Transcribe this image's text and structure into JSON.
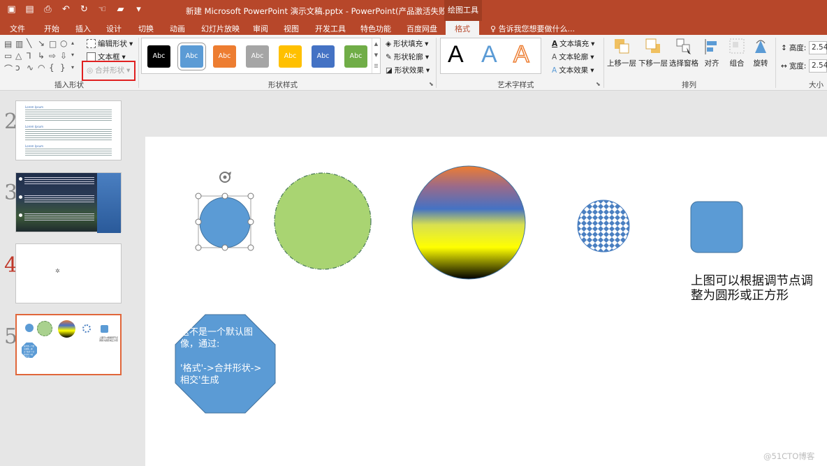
{
  "titlebar": {
    "title": "新建 Microsoft PowerPoint 演示文稿.pptx - PowerPoint(产品激活失败)",
    "context_tab": "绘图工具"
  },
  "tabs": [
    "文件",
    "开始",
    "插入",
    "设计",
    "切换",
    "动画",
    "幻灯片放映",
    "审阅",
    "视图",
    "开发工具",
    "特色功能",
    "百度网盘",
    "格式"
  ],
  "tell_me": "告诉我您想要做什么...",
  "ribbon": {
    "insert_shapes": {
      "edit_shape": "编辑形状",
      "text_box": "文本框",
      "merge_shapes": "合并形状",
      "label": "插入形状"
    },
    "shape_styles": {
      "swatches": [
        {
          "text": "Abc",
          "bg": "#000000",
          "fg": "#ffffff"
        },
        {
          "text": "Abc",
          "bg": "#5b9bd5",
          "fg": "#ffffff"
        },
        {
          "text": "Abc",
          "bg": "#ed7d31",
          "fg": "#ffffff"
        },
        {
          "text": "Abc",
          "bg": "#a5a5a5",
          "fg": "#ffffff"
        },
        {
          "text": "Abc",
          "bg": "#ffc000",
          "fg": "#ffffff"
        },
        {
          "text": "Abc",
          "bg": "#4472c4",
          "fg": "#ffffff"
        },
        {
          "text": "Abc",
          "bg": "#70ad47",
          "fg": "#ffffff"
        }
      ],
      "fill": "形状填充",
      "outline": "形状轮廓",
      "effects": "形状效果",
      "label": "形状样式"
    },
    "wordart": {
      "letter": "A",
      "text_fill": "文本填充",
      "text_outline": "文本轮廓",
      "text_effects": "文本效果",
      "label": "艺术字样式"
    },
    "arrange": {
      "bring_forward": "上移一层",
      "send_backward": "下移一层",
      "selection_pane": "选择窗格",
      "align": "对齐",
      "group": "组合",
      "rotate": "旋转",
      "label": "排列"
    },
    "size": {
      "height_label": "高度:",
      "height_value": "2.54",
      "width_label": "宽度:",
      "width_value": "2.54",
      "label": "大小"
    }
  },
  "slides": {
    "numbers": [
      "2",
      "3",
      "4",
      "5"
    ]
  },
  "slide": {
    "caption": "上图可以根据调节点调整为圆形或正方形",
    "octagon_text_1": "这不是一个默认图像，通过:",
    "octagon_text_2": "'格式'->合并形状->相交'生成"
  },
  "thumbnail_text": {
    "lorem_title": "Lorem Ipsum",
    "caption_small": "上图可以根据调节点调整为圆形或正方形",
    "octagon_small": "这不是一个默认图像，通过:'格式'->合并形状->相交'生成"
  },
  "watermark": "@51CTO博客"
}
